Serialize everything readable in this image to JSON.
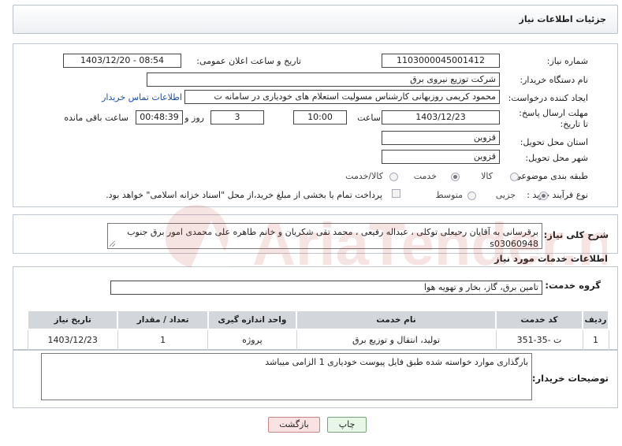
{
  "header": {
    "title": "جزئیات اطلاعات نیاز"
  },
  "fields": {
    "need_number_label": "شماره نیاز:",
    "need_number": "1103000045001412",
    "announce_label": "تاریخ و ساعت اعلان عمومی:",
    "announce_value": "1403/12/20 - 08:54",
    "buyer_org_label": "نام دستگاه خریدار:",
    "buyer_org": "شرکت توزیع نیروی برق",
    "requester_label": "ایجاد کننده درخواست:",
    "requester": "محمود کریمی روزبهانی کارشناس  مسولیت استعلام های خودیاری در سامانه ت",
    "contact_link": "اطلاعات تماس خریدار",
    "deadline_label": "مهلت ارسال پاسخ: تا تاریخ:",
    "deadline_date": "1403/12/23",
    "time_label": "ساعت",
    "deadline_time": "10:00",
    "days_value": "3",
    "days_label": "روز و",
    "remaining_time": "00:48:39",
    "remaining_label": "ساعت باقی مانده",
    "province_label": "استان محل تحویل:",
    "province": "قزوین",
    "city_label": "شهر محل تحویل:",
    "city": "قزوین",
    "category_label": "طبقه بندی موضوعی:",
    "category_options": [
      "کالا",
      "خدمت",
      "کالا/خدمت"
    ],
    "category_selected": "خدمت",
    "process_label": "نوع فرآیند خرید :",
    "process_options": [
      "جزیی",
      "متوسط"
    ],
    "process_selected": "جزیی",
    "treasury_note": "پرداخت تمام یا بخشی از مبلغ خرید،از محل \"اسناد خزانه اسلامی\" خواهد بود."
  },
  "description": {
    "label": "شرح کلی نیاز:",
    "text": "برقرسانی به آقایان رحیعلی توکلی ، عبداله رفیعی ، محمد تقی شکریان و خانم طاهره علی محمدی امور برق جنوب s03060948"
  },
  "services": {
    "section_title": "اطلاعات خدمات مورد نیاز",
    "group_label": "گروه خدمت:",
    "group_value": "تامین برق، گاز، بخار و تهویه هوا",
    "columns": [
      "ردیف",
      "کد خدمت",
      "نام خدمت",
      "واحد اندازه گیری",
      "تعداد / مقدار",
      "تاریخ نیاز"
    ],
    "rows": [
      {
        "row": "1",
        "code": "ت -35-351",
        "name": "تولید، انتقال و توزیع برق",
        "unit": "پروژه",
        "qty": "1",
        "date": "1403/12/23"
      }
    ]
  },
  "buyer_notes": {
    "label": "توضیحات خریدار:",
    "text": "بارگذاری موارد خواسته شده طبق فایل پیوست خودیاری 1 الزامی میباشد"
  },
  "buttons": {
    "print": "چاپ",
    "back": "بازگشت"
  },
  "watermark": {
    "text": "AriaTender.neT"
  },
  "colors": {
    "accent": "#1b4fa3",
    "print_bg": "#e7f6e7",
    "back_bg": "#f9e2e2",
    "header_bg": "#d3d7dc"
  }
}
